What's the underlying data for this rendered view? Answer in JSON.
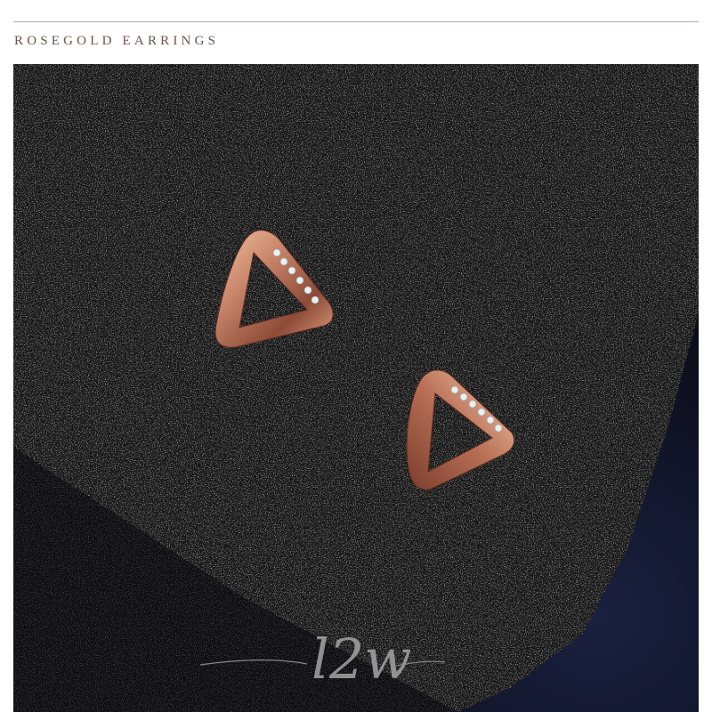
{
  "header": {
    "title": "ROSEGOLD EARRINGS"
  },
  "photo": {
    "subject": "rose-gold-triangle-stud-earrings",
    "background": "black-sparkle-foam",
    "watermark_text": "l2w"
  },
  "colors": {
    "title": "#6e5148",
    "rule": "#b3aaa5",
    "rose_gold": "#c98a6a",
    "foam": "#1c1c1c",
    "backdrop": "#0b0d1a"
  }
}
